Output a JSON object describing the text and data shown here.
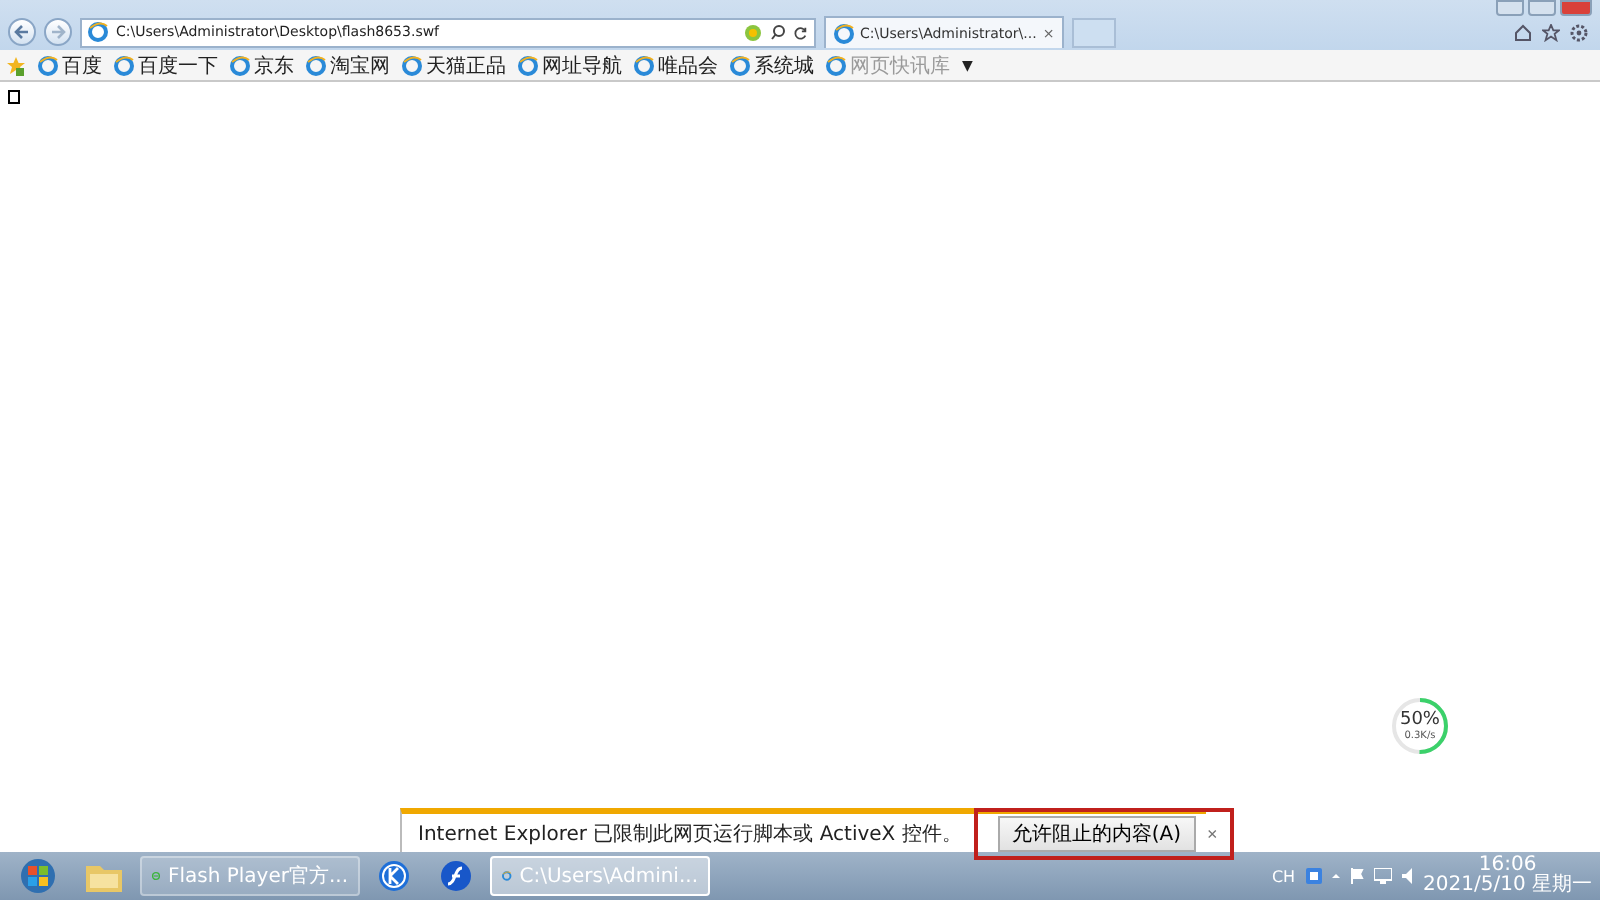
{
  "browser": {
    "address": "C:\\Users\\Administrator\\Desktop\\flash8653.swf",
    "tabs": [
      {
        "label": "C:\\Users\\Administrator\\...",
        "close": "×",
        "selected": true
      }
    ],
    "favorites": [
      {
        "label": "百度",
        "disabled": false
      },
      {
        "label": "百度一下",
        "disabled": false
      },
      {
        "label": "京东",
        "disabled": false
      },
      {
        "label": "淘宝网",
        "disabled": false
      },
      {
        "label": "天猫正品",
        "disabled": false
      },
      {
        "label": "网址导航",
        "disabled": false
      },
      {
        "label": "唯品会",
        "disabled": false
      },
      {
        "label": "系统城",
        "disabled": false
      },
      {
        "label": "网页快讯库",
        "disabled": true
      }
    ],
    "favorites_more": "▼"
  },
  "speed_widget": {
    "percent": "50%",
    "speed": "0.3K/s",
    "level": 0.5
  },
  "notification": {
    "message": "Internet Explorer 已限制此网页运行脚本或 ActiveX 控件。",
    "button": "允许阻止的内容(A)",
    "close": "×",
    "highlighted": true
  },
  "taskbar": {
    "buttons": [
      {
        "kind": "start",
        "selected": false
      },
      {
        "kind": "folder",
        "selected": false
      },
      {
        "kind": "browser",
        "label": "Flash Player官方...",
        "selected": false
      },
      {
        "kind": "kapp",
        "selected": false
      },
      {
        "kind": "flash",
        "selected": false
      },
      {
        "kind": "ie",
        "label": "C:\\Users\\Admini...",
        "selected": true
      }
    ],
    "language": "CH",
    "time": "16:06",
    "date": "2021/5/10 星期一"
  }
}
